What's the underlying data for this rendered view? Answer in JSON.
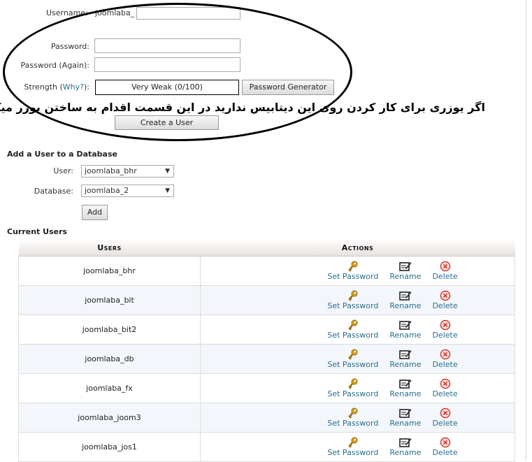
{
  "form": {
    "username_label": "Username:",
    "username_prefix": "joomlaba_",
    "password_label": "Password:",
    "password_again_label": "Password (Again):",
    "strength_label": "Strength (",
    "why_link": "Why?",
    "strength_suffix": "):",
    "strength_value": "Very Weak (0/100)",
    "password_generator_button": "Password Generator",
    "create_user_button": "Create a User"
  },
  "annotation": {
    "persian_text": "اگر یوزری برای کار کردن روی این دیتابیس ندارید در این قسمت اقدام به ساختن یوزر میکنید"
  },
  "add_user": {
    "title": "Add a User to a Database",
    "user_label": "User:",
    "user_value": "joomlaba_bhr",
    "database_label": "Database:",
    "database_value": "joomlaba_2",
    "add_button": "Add"
  },
  "current_users": {
    "title": "Current Users",
    "col_users": "Users",
    "col_actions": "Actions",
    "action_set_password": "Set Password",
    "action_rename": "Rename",
    "action_delete": "Delete",
    "rows": [
      "joomlaba_bhr",
      "joomlaba_bit",
      "joomlaba_bit2",
      "joomlaba_db",
      "joomlaba_fx",
      "joomlaba_joom3",
      "joomlaba_jos1"
    ]
  },
  "icons": {
    "set_password": "key-icon",
    "rename": "rename-icon",
    "delete": "delete-icon"
  },
  "colors": {
    "link": "#2a6e8a",
    "delete_red": "#d9362b",
    "key_gold": "#d9a521"
  }
}
